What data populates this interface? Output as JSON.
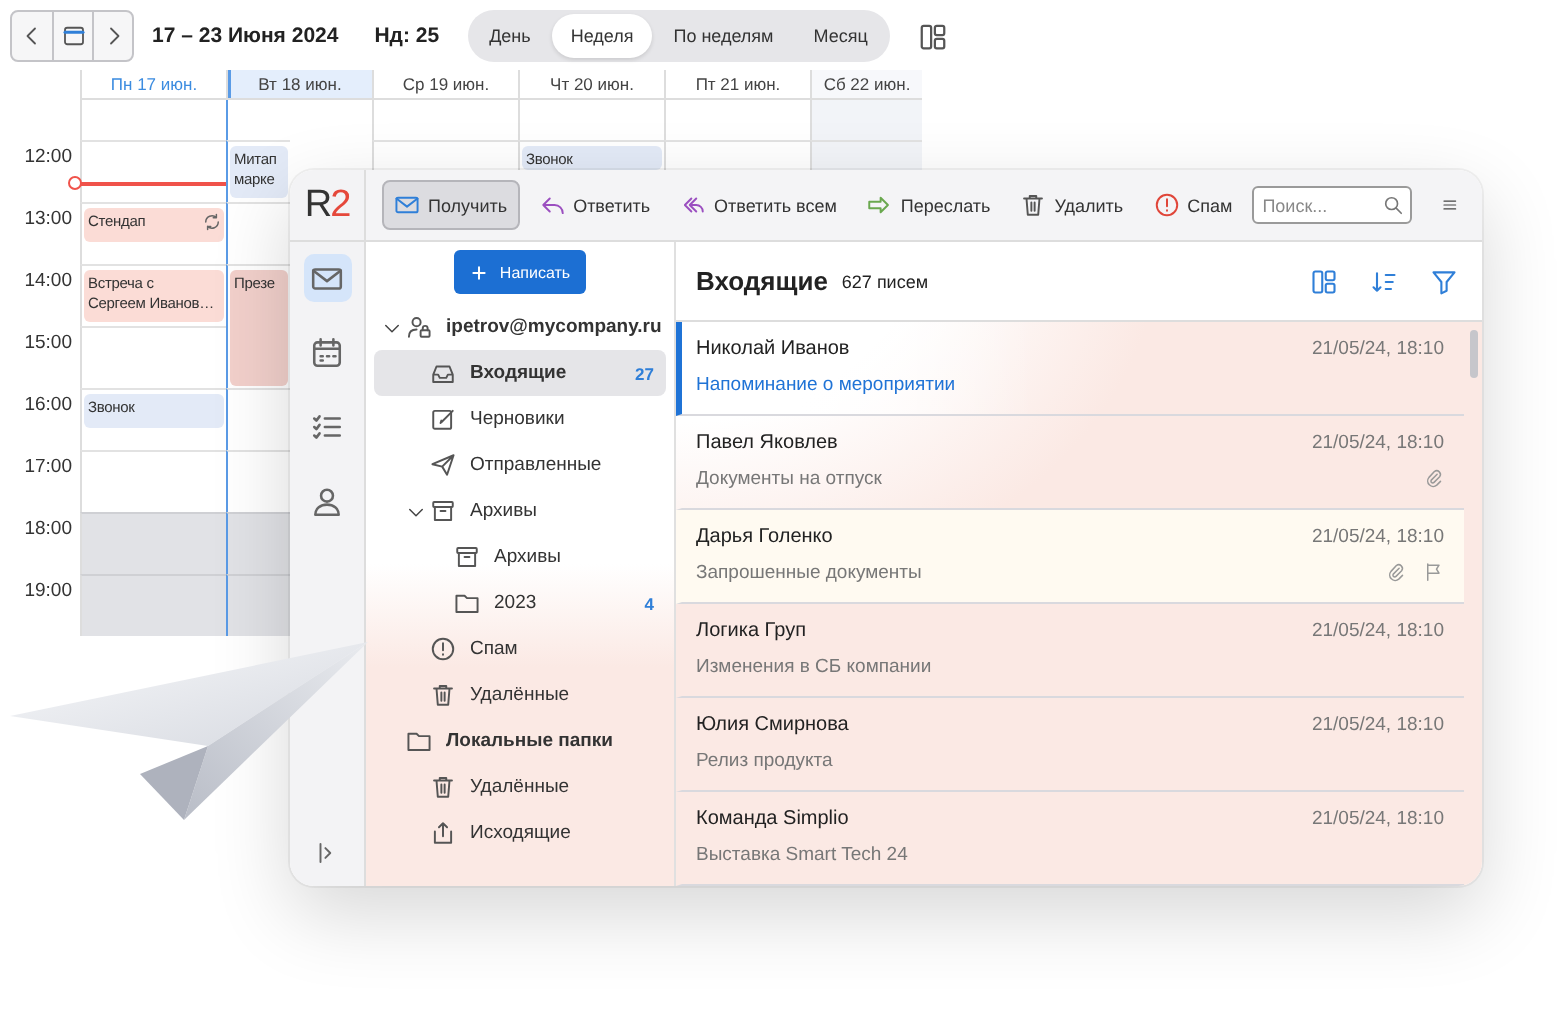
{
  "calendar": {
    "toolbar": {
      "range": "17 – 23 Июня 2024",
      "week": "Нд: 25",
      "views": [
        {
          "label": "День",
          "selected": false
        },
        {
          "label": "Неделя",
          "selected": true
        },
        {
          "label": "По неделям",
          "selected": false
        },
        {
          "label": "Месяц",
          "selected": false
        }
      ]
    },
    "days": [
      {
        "label": "Пн 17 июн.",
        "today": true,
        "selected": false,
        "weekend": false
      },
      {
        "label": "Вт 18 июн.",
        "today": false,
        "selected": true,
        "weekend": false
      },
      {
        "label": "Ср 19 июн.",
        "today": false,
        "selected": false,
        "weekend": false
      },
      {
        "label": "Чт 20 июн.",
        "today": false,
        "selected": false,
        "weekend": false
      },
      {
        "label": "Пт 21 июн.",
        "today": false,
        "selected": false,
        "weekend": false
      },
      {
        "label": "Сб 22 июн.",
        "today": false,
        "selected": false,
        "weekend": true
      }
    ],
    "hours": [
      {
        "label": "12:00",
        "off": false,
        "now": true,
        "cells": [
          {
            "kind": "empty"
          },
          {
            "kind": "event",
            "lines": [
              "Митап",
              "марке"
            ],
            "color": "#e3eaf7",
            "recurring": false
          },
          {
            "kind": "empty"
          },
          {
            "kind": "event",
            "lines": [
              "Звонок"
            ],
            "color": "#e3eaf7",
            "recurring": false
          },
          {
            "kind": "empty"
          },
          {
            "kind": "empty"
          }
        ]
      },
      {
        "label": "13:00",
        "off": false,
        "now": false,
        "cells": [
          {
            "kind": "short",
            "lines": [
              "Стендап"
            ],
            "color": "#fbdcd6",
            "recurring": true
          },
          {
            "kind": "empty"
          },
          {
            "kind": "empty"
          },
          {
            "kind": "empty"
          },
          {
            "kind": "empty"
          },
          {
            "kind": "empty"
          }
        ]
      },
      {
        "label": "14:00",
        "off": false,
        "now": false,
        "cells": [
          {
            "kind": "event",
            "lines": [
              "Встреча с",
              "Сергеем Иванов…"
            ],
            "color": "#fbdcd6",
            "recurring": false
          },
          {
            "kind": "long",
            "lines": [
              "Презе"
            ],
            "color": "#f2d0cb",
            "recurring": false
          },
          {
            "kind": "empty"
          },
          {
            "kind": "empty"
          },
          {
            "kind": "empty"
          },
          {
            "kind": "empty"
          }
        ]
      },
      {
        "label": "15:00",
        "off": false,
        "now": false,
        "cells": [
          {
            "kind": "empty"
          },
          {
            "kind": "covered"
          },
          {
            "kind": "empty"
          },
          {
            "kind": "empty"
          },
          {
            "kind": "empty"
          },
          {
            "kind": "empty"
          }
        ]
      },
      {
        "label": "16:00",
        "off": false,
        "now": false,
        "cells": [
          {
            "kind": "short",
            "lines": [
              "Звонок"
            ],
            "color": "#e3eaf7",
            "recurring": false
          },
          {
            "kind": "empty"
          },
          {
            "kind": "empty"
          },
          {
            "kind": "empty"
          },
          {
            "kind": "empty"
          },
          {
            "kind": "empty"
          }
        ]
      },
      {
        "label": "17:00",
        "off": false,
        "now": false,
        "cells": [
          {
            "kind": "empty"
          },
          {
            "kind": "empty"
          },
          {
            "kind": "empty"
          },
          {
            "kind": "empty"
          },
          {
            "kind": "empty"
          },
          {
            "kind": "empty"
          }
        ]
      },
      {
        "label": "18:00",
        "off": true,
        "now": false,
        "cells": [
          {
            "kind": "empty"
          },
          {
            "kind": "empty"
          },
          {
            "kind": "empty"
          },
          {
            "kind": "empty"
          },
          {
            "kind": "empty"
          },
          {
            "kind": "empty"
          }
        ]
      },
      {
        "label": "19:00",
        "off": true,
        "now": false,
        "cells": [
          {
            "kind": "empty"
          },
          {
            "kind": "empty"
          },
          {
            "kind": "empty"
          },
          {
            "kind": "empty"
          },
          {
            "kind": "empty"
          },
          {
            "kind": "empty"
          }
        ]
      }
    ]
  },
  "mail": {
    "logo": "R2",
    "rail": [
      {
        "kind": "mail",
        "selected": true
      },
      {
        "kind": "calendar",
        "selected": false
      },
      {
        "kind": "tasks",
        "selected": false
      },
      {
        "kind": "contacts",
        "selected": false
      }
    ],
    "toolbar": [
      {
        "kind": "receive",
        "label": "Получить",
        "pressed": true
      },
      {
        "kind": "reply",
        "label": "Ответить",
        "pressed": false
      },
      {
        "kind": "reply_all",
        "label": "Ответить всем",
        "pressed": false
      },
      {
        "kind": "forward",
        "label": "Переслать",
        "pressed": false
      },
      {
        "kind": "delete",
        "label": "Удалить",
        "pressed": false
      },
      {
        "kind": "spam",
        "label": "Спам",
        "pressed": false
      }
    ],
    "search": {
      "placeholder": "Поиск..."
    },
    "compose": "Написать",
    "folders": [
      {
        "name": "ipetrov@mycompany.ru",
        "kind": "account",
        "selected": false,
        "expanded": true,
        "children": [
          {
            "name": "Входящие",
            "kind": "inbox",
            "selected": true,
            "count": "27"
          },
          {
            "name": "Черновики",
            "kind": "drafts",
            "selected": false
          },
          {
            "name": "Отправленные",
            "kind": "sent",
            "selected": false
          },
          {
            "name": "Архивы",
            "kind": "archive",
            "selected": false,
            "expanded": true,
            "children": [
              {
                "name": "Архивы",
                "kind": "archive",
                "selected": false
              },
              {
                "name": "2023",
                "kind": "folder",
                "selected": false,
                "count": "4"
              }
            ]
          },
          {
            "name": "Спам",
            "kind": "spam",
            "selected": false
          },
          {
            "name": "Удалённые",
            "kind": "trash",
            "selected": false
          }
        ]
      },
      {
        "name": "Локальные папки",
        "kind": "local",
        "selected": false,
        "children": [
          {
            "name": "Удалённые",
            "kind": "trash",
            "selected": false
          },
          {
            "name": "Исходящие",
            "kind": "outbox",
            "selected": false
          }
        ]
      }
    ],
    "list": {
      "title": "Входящие",
      "count": "627 писем",
      "messages": [
        {
          "sender": "Николай Иванов",
          "subject": "Напоминание о мероприятии",
          "date": "21/05/24, 18:10",
          "selected": true,
          "attachment": false,
          "flagged": false
        },
        {
          "sender": "Павел Яковлев",
          "subject": "Документы на отпуск",
          "date": "21/05/24, 18:10",
          "selected": false,
          "attachment": true,
          "flagged": false
        },
        {
          "sender": "Дарья Голенко",
          "subject": "Запрошенные документы",
          "date": "21/05/24, 18:10",
          "selected": false,
          "attachment": true,
          "flagged": true
        },
        {
          "sender": "Логика Груп",
          "subject": "Изменения в СБ компании",
          "date": "21/05/24, 18:10",
          "selected": false,
          "attachment": false,
          "flagged": false
        },
        {
          "sender": "Юлия Смирнова",
          "subject": "Релиз продукта",
          "date": "21/05/24, 18:10",
          "selected": false,
          "attachment": false,
          "flagged": false
        },
        {
          "sender": "Команда Simplio",
          "subject": "Выставка Smart Tech 24",
          "date": "21/05/24, 18:10",
          "selected": false,
          "attachment": false,
          "flagged": false
        }
      ]
    }
  }
}
